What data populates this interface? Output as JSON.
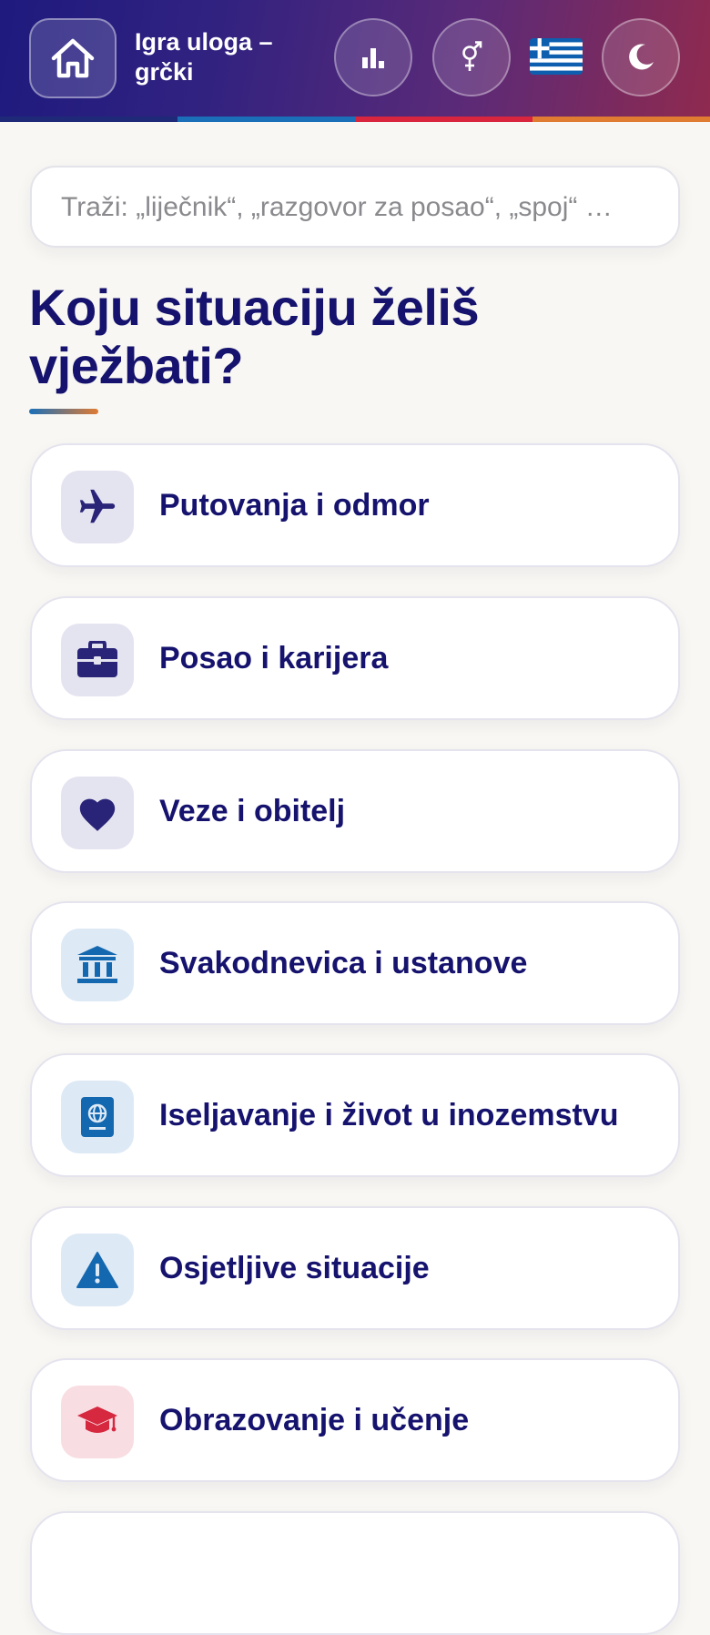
{
  "header": {
    "title": "Igra uloga –\ngrčki",
    "home_icon": "home-icon",
    "stats_icon": "bar-chart-icon",
    "gender_icon": "gender-icon",
    "flag_icon": "greek-flag-icon",
    "theme_icon": "moon-icon",
    "stripe_colors": [
      "#1e2a78",
      "#1b6fb8",
      "#d9263e",
      "#e07b32"
    ]
  },
  "search": {
    "placeholder": "Traži: „liječnik“, „razgovor za posao“, „spoj“ …"
  },
  "main": {
    "heading": "Koju situaciju želiš vježbati?"
  },
  "categories": [
    {
      "label": "Putovanja i odmor",
      "icon": "airplane-icon",
      "icon_color": "#2a2478",
      "icon_bg": "#e4e3f0"
    },
    {
      "label": "Posao i karijera",
      "icon": "briefcase-icon",
      "icon_color": "#2a2478",
      "icon_bg": "#e4e3f0"
    },
    {
      "label": "Veze i obitelj",
      "icon": "heart-icon",
      "icon_color": "#2a2478",
      "icon_bg": "#e4e3f0"
    },
    {
      "label": "Svakodnevica i ustanove",
      "icon": "institution-icon",
      "icon_color": "#1468b0",
      "icon_bg": "#dde9f5"
    },
    {
      "label": "Iseljavanje i život u inozemstvu",
      "icon": "passport-icon",
      "icon_color": "#1468b0",
      "icon_bg": "#dde9f5"
    },
    {
      "label": "Osjetljive situacije",
      "icon": "warning-icon",
      "icon_color": "#1468b0",
      "icon_bg": "#dde9f5"
    },
    {
      "label": "Obrazovanje i učenje",
      "icon": "graduation-cap-icon",
      "icon_color": "#d6283e",
      "icon_bg": "#f8dde2"
    }
  ]
}
